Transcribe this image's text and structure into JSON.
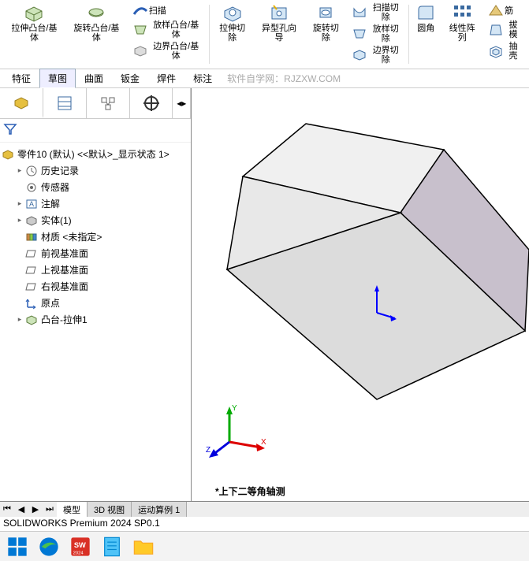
{
  "ribbon": {
    "extrudeBoss": "拉伸凸台/基体",
    "revolveBoss": "旋转凸台/基体",
    "sweep": "扫描",
    "loftBoss": "放样凸台/基体",
    "boundaryBoss": "边界凸台/基体",
    "extrudeCut": "拉伸切除",
    "holeWizard": "异型孔向导",
    "revolveCut": "旋转切除",
    "sweepCut": "扫描切除",
    "loftCut": "放样切除",
    "boundaryCut": "边界切除",
    "fillet": "圆角",
    "linearPattern": "线性阵列",
    "rib": "筋",
    "draft": "拔模",
    "shell": "抽壳"
  },
  "tabs": {
    "feature": "特征",
    "sketch": "草图",
    "surface": "曲面",
    "sheetMetal": "钣金",
    "weldment": "焊件",
    "annotate": "标注"
  },
  "watermark": "软件自学网：RJZXW.COM",
  "tree": {
    "root": "零件10 (默认) <<默认>_显示状态 1>",
    "history": "历史记录",
    "sensors": "传感器",
    "annotations": "注解",
    "solid": "实体(1)",
    "material": "材质 <未指定>",
    "front": "前视基准面",
    "top": "上视基准面",
    "right": "右视基准面",
    "origin": "原点",
    "feature1": "凸台-拉伸1"
  },
  "viewLabel": "*上下二等角轴测",
  "bottomTabs": {
    "model": "模型",
    "view3d": "3D 视图",
    "motion": "运动算例 1"
  },
  "status": "SOLIDWORKS Premium 2024 SP0.1",
  "triad": {
    "x": "X",
    "y": "Y",
    "z": "Z"
  }
}
